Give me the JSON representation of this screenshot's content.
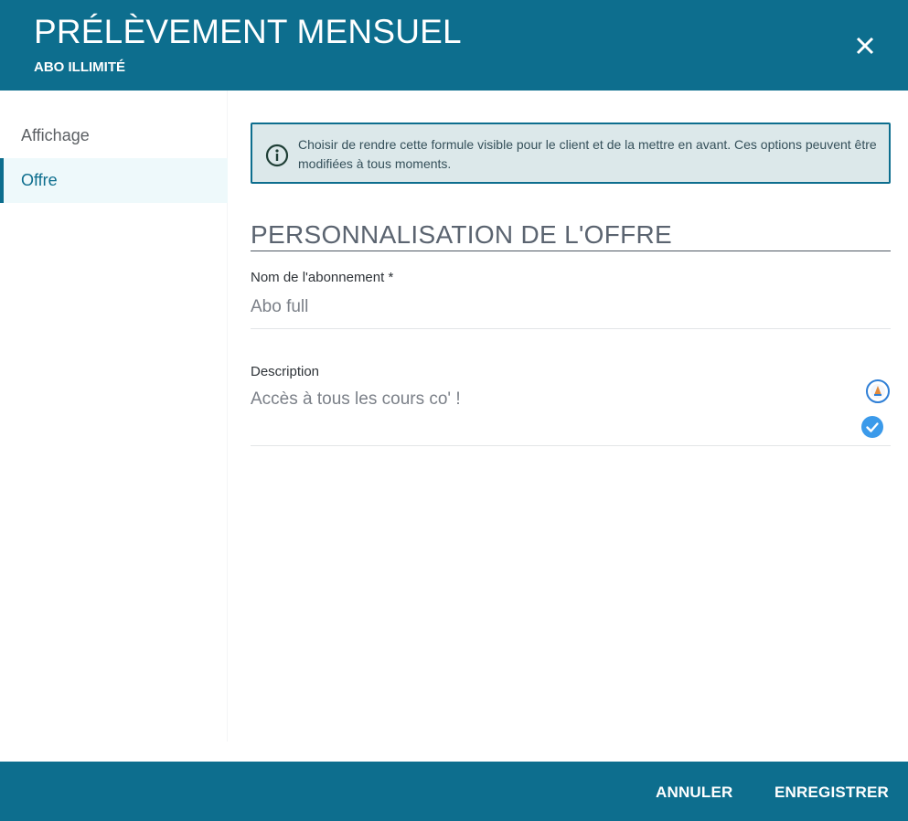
{
  "header": {
    "title": "PRÉLÈVEMENT MENSUEL",
    "subtitle": "ABO ILLIMITÉ",
    "close_icon": "close-icon"
  },
  "sidebar": {
    "items": [
      {
        "label": "Affichage",
        "active": false
      },
      {
        "label": "Offre",
        "active": true
      }
    ]
  },
  "info": {
    "icon": "info-icon",
    "text": "Choisir de rendre cette formule visible pour le client et de la mettre en avant. Ces options peuvent être modifiées à tous moments."
  },
  "section": {
    "title": "PERSONNALISATION DE L'OFFRE"
  },
  "fields": {
    "name": {
      "label": "Nom de l'abonnement *",
      "value": "Abo full"
    },
    "description": {
      "label": "Description",
      "value": "Accès à tous les cours co' !"
    }
  },
  "icons": {
    "extension_icon": "grammar-extension-icon",
    "check_icon": "check-circle-icon"
  },
  "footer": {
    "cancel_label": "ANNULER",
    "save_label": "ENREGISTRER"
  },
  "colors": {
    "primary": "#0d6e8e",
    "info_bg": "#dce8ea",
    "active_bg": "#eef9fb",
    "check_blue": "#3b9aea"
  }
}
